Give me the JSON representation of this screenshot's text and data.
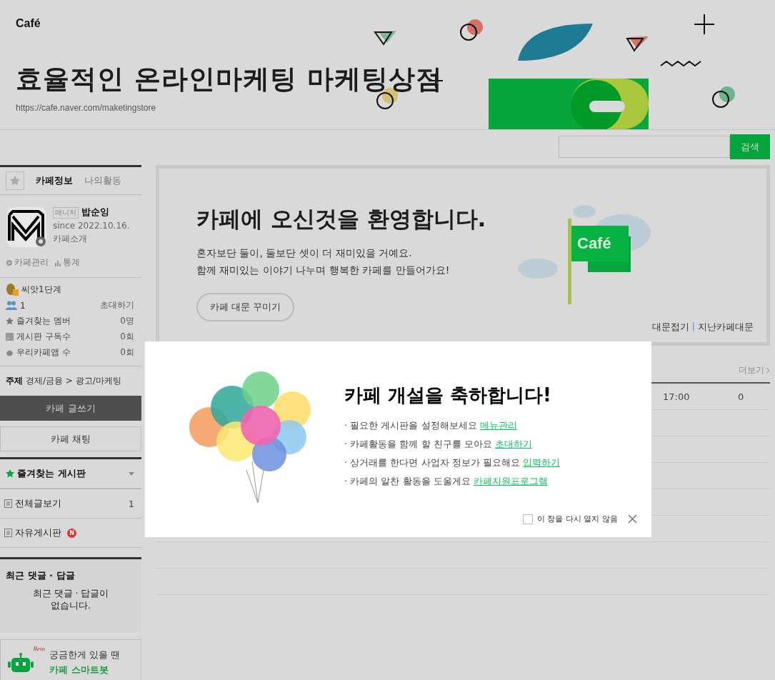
{
  "header": {
    "logo": "Café",
    "title": "효율적인 온라인마케팅 마케팅상점",
    "url": "https://cafe.naver.com/maketingstore"
  },
  "search": {
    "button": "검색"
  },
  "sidebar": {
    "tabs": [
      {
        "label": "카페정보",
        "selected": true
      },
      {
        "label": "나의활동",
        "selected": false
      }
    ],
    "profile": {
      "role": "매니저",
      "name": "밥순잉",
      "since": "since 2022.10.16.",
      "intro": "카페소개"
    },
    "tools": [
      "카페관리",
      "통계"
    ],
    "level": "씨앗1단계",
    "members": "1",
    "invite": "초대하기",
    "stats": [
      {
        "kind": "star",
        "label": "즐겨찾는 멤버",
        "value": "0명"
      },
      {
        "kind": "feed",
        "label": "게시판 구독수",
        "value": "0회"
      },
      {
        "kind": "app",
        "label": "우리카페앱 수",
        "value": "0회"
      }
    ],
    "topic_label": "주제",
    "topic": "경제/금융 > 광고/마케팅",
    "write_button": "카페 글쓰기",
    "chat_button": "카페 채팅",
    "favorites": "즐겨찾는 게시판",
    "boards": [
      {
        "name": "전체글보기",
        "count": "1",
        "new": false
      },
      {
        "name": "자유게시판",
        "new": true,
        "badge": "N"
      }
    ],
    "recent_title": "최근 댓글 · 답글",
    "recent_empty": "최근 댓글 · 답글이 없습니다.",
    "bot": {
      "beta": "Beta",
      "line1": "궁금한게 있을 땐",
      "line2": "카페 스마트봇"
    }
  },
  "welcome": {
    "title": "카페에 오신것을 환영합니다.",
    "lines": [
      "혼자보단 둘이, 둘보단 셋이 더 재미있을 거예요.",
      "함께 재미있는 이야기 나누며 행복한 카페를 만들어가요!"
    ],
    "button": "카페 대문 꾸미기",
    "flag": "Café",
    "links": [
      "대문접기",
      "지난카페대문"
    ],
    "separator": "|"
  },
  "list": {
    "more": "더보기",
    "rows": [
      {
        "time": "17:00",
        "count": "0"
      }
    ]
  },
  "modal": {
    "title": "카페 개설을 축하합니다!",
    "items": [
      {
        "text": "· 필요한 게시판을 설정해보세요",
        "link": "메뉴관리"
      },
      {
        "text": "· 카페활동을 함께 할 친구를 모아요",
        "link": "초대하기"
      },
      {
        "text": "· 상거래를 한다면 사업자 정보가 필요해요",
        "link": "입력하기"
      },
      {
        "text": "· 카페의 알찬 활동을 도울게요",
        "link": "카페지원프로그램"
      }
    ],
    "dont_show": "이 창을 다시 열지 않음",
    "checked": false
  }
}
